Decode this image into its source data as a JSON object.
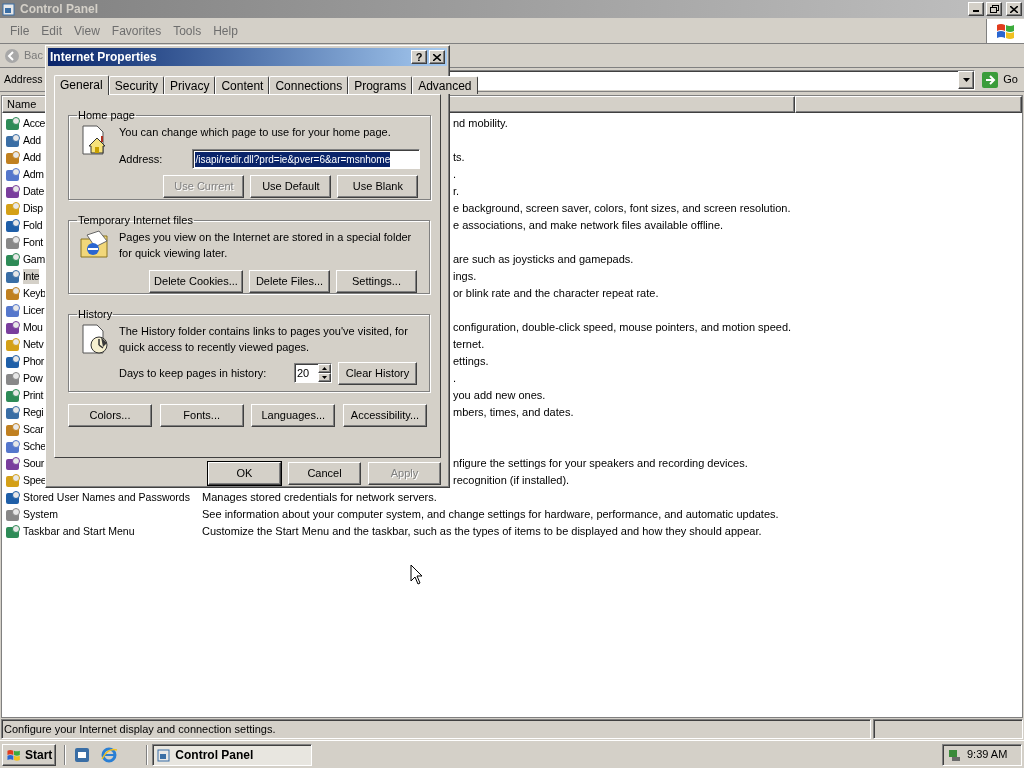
{
  "window": {
    "title": "Control Panel"
  },
  "menu": [
    "File",
    "Edit",
    "View",
    "Favorites",
    "Tools",
    "Help"
  ],
  "toolbar": {
    "back": "Bac"
  },
  "address_bar": {
    "label": "Address",
    "go": "Go"
  },
  "columns": [
    "Name"
  ],
  "items": [
    {
      "name": "Acce",
      "description": "nd mobility.",
      "kind": "partial",
      "selected": false
    },
    {
      "name": "Add",
      "kind": "partial",
      "selected": false
    },
    {
      "name": "Add",
      "description": "ts.",
      "kind": "partial",
      "selected": false
    },
    {
      "name": "Adm",
      "description": ".",
      "kind": "partial",
      "selected": false
    },
    {
      "name": "Date",
      "description": "r.",
      "kind": "partial",
      "selected": false
    },
    {
      "name": "Disp",
      "description": "e background, screen saver, colors, font sizes, and screen resolution.",
      "kind": "partial",
      "selected": false
    },
    {
      "name": "Fold",
      "description": "e associations, and make network files available offline.",
      "kind": "partial",
      "selected": false
    },
    {
      "name": "Font",
      "kind": "partial",
      "selected": false
    },
    {
      "name": "Gam",
      "description": "are such as joysticks and gamepads.",
      "kind": "partial",
      "selected": false
    },
    {
      "name": "Inte",
      "description": "ings.",
      "kind": "partial",
      "selected": true
    },
    {
      "name": "Keyb",
      "description": "or blink rate and the character repeat rate.",
      "kind": "partial",
      "selected": false
    },
    {
      "name": "Licer",
      "kind": "partial",
      "selected": false
    },
    {
      "name": "Mou",
      "description": "configuration, double-click speed, mouse pointers, and motion speed.",
      "kind": "partial",
      "selected": false
    },
    {
      "name": "Netv",
      "description": "ternet.",
      "kind": "partial",
      "selected": false
    },
    {
      "name": "Phor",
      "description": "ettings.",
      "kind": "partial",
      "selected": false
    },
    {
      "name": "Pow",
      "description": ".",
      "kind": "partial",
      "selected": false
    },
    {
      "name": "Print",
      "description": "you add new ones.",
      "kind": "partial",
      "selected": false
    },
    {
      "name": "Regi",
      "description": "mbers, times, and dates.",
      "kind": "partial",
      "selected": false
    },
    {
      "name": "Scar",
      "kind": "partial",
      "selected": false
    },
    {
      "name": "Sche",
      "kind": "partial",
      "selected": false
    },
    {
      "name": "Sour",
      "description": "nfigure the settings for your speakers and recording devices.",
      "kind": "partial",
      "selected": false
    },
    {
      "name": "Spee",
      "description": "recognition (if installed).",
      "kind": "partial",
      "selected": false
    },
    {
      "name": "Stored User Names and Passwords",
      "description": "Manages stored credentials for network servers.",
      "kind": "full",
      "selected": false
    },
    {
      "name": "System",
      "description": "See information about your computer system, and change settings for hardware, performance, and automatic updates.",
      "kind": "full",
      "selected": false
    },
    {
      "name": "Taskbar and Start Menu",
      "description": "Customize the Start Menu and the taskbar, such as the types of items to be displayed and how they should appear.",
      "kind": "full",
      "selected": false
    }
  ],
  "status_bar": "Configure your Internet display and connection settings.",
  "taskbar": {
    "start": "Start",
    "tasks": [
      {
        "label": "Control Panel",
        "selected": true
      }
    ],
    "clock": "9:39 AM"
  },
  "dialog": {
    "title": "Internet Properties",
    "help": "?",
    "tabs": [
      {
        "label": "General",
        "selected": true
      },
      {
        "label": "Security",
        "selected": false
      },
      {
        "label": "Privacy",
        "selected": false
      },
      {
        "label": "Content",
        "selected": false
      },
      {
        "label": "Connections",
        "selected": false
      },
      {
        "label": "Programs",
        "selected": false
      },
      {
        "label": "Advanced",
        "selected": false
      }
    ],
    "home_page": {
      "legend": "Home page",
      "text": "You can change which page to use for your home page.",
      "address_label": "Address:",
      "address_value": "/isapi/redir.dll?prd=ie&pver=6&ar=msnhome",
      "address_selected": true,
      "buttons": [
        {
          "label": "Use Current",
          "disabled": true
        },
        {
          "label": "Use Default",
          "disabled": false
        },
        {
          "label": "Use Blank",
          "disabled": false
        }
      ]
    },
    "temp_files": {
      "legend": "Temporary Internet files",
      "text": "Pages you view on the Internet are stored in a special folder for quick viewing later.",
      "buttons": [
        {
          "label": "Delete Cookies...",
          "disabled": false
        },
        {
          "label": "Delete Files...",
          "disabled": false
        },
        {
          "label": "Settings...",
          "disabled": false
        }
      ]
    },
    "history": {
      "legend": "History",
      "text": "The History folder contains links to pages you've visited, for quick access to recently viewed pages.",
      "days_label": "Days to keep pages in history:",
      "days": "20",
      "button": "Clear History"
    },
    "bottom_buttons": [
      "Colors...",
      "Fonts...",
      "Languages...",
      "Accessibility..."
    ],
    "footer_buttons": [
      {
        "label": "OK",
        "disabled": false,
        "default": true
      },
      {
        "label": "Cancel",
        "disabled": false,
        "default": false
      },
      {
        "label": "Apply",
        "disabled": true,
        "default": false
      }
    ]
  }
}
